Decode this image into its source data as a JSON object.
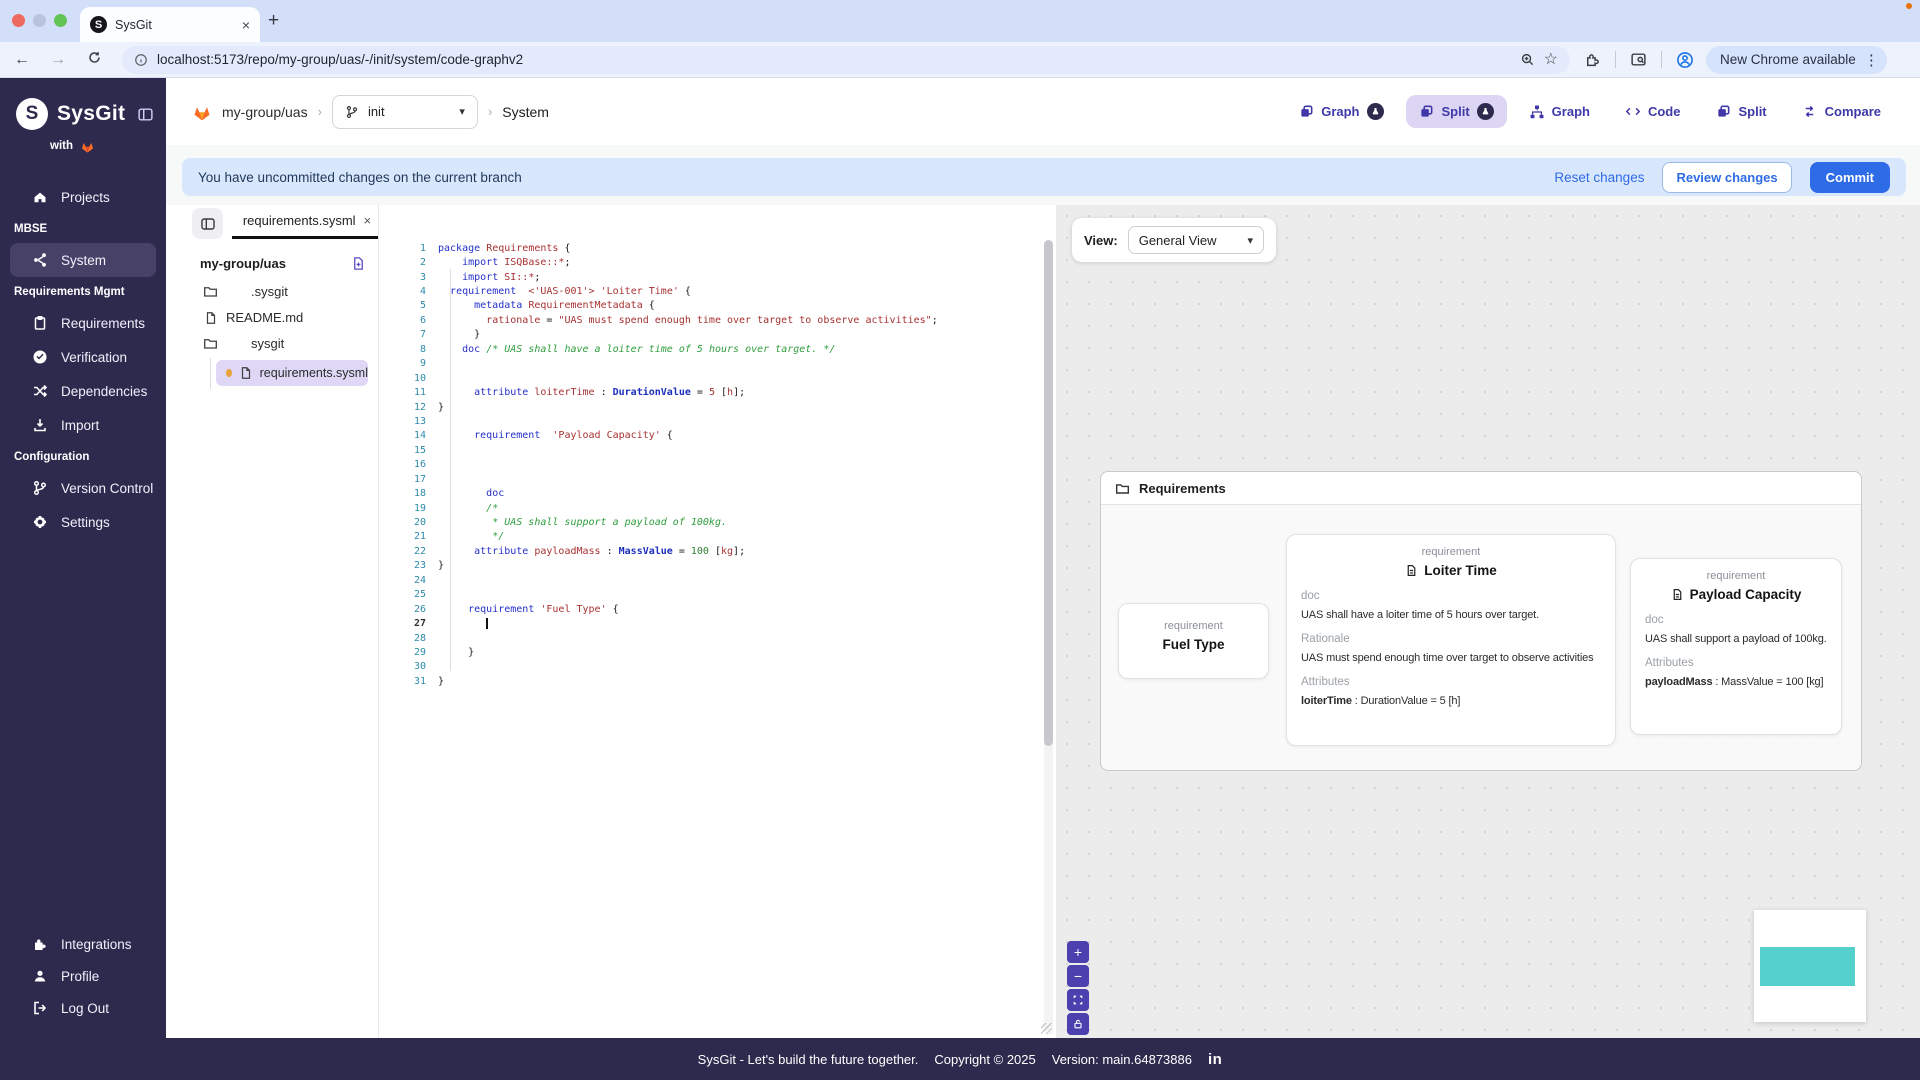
{
  "browser": {
    "tab_title": "SysGit",
    "favicon_letter": "S",
    "url": "localhost:5173/repo/my-group/uas/-/init/system/code-graphv2",
    "update_pill": "New Chrome available"
  },
  "icons": {
    "close": "×",
    "new-tab": "+",
    "back": "←",
    "forward": "→",
    "kebab": "⋮",
    "caret-down": "▾",
    "star": "☆",
    "plus": "+",
    "minus": "−",
    "linkedin": "in"
  },
  "sidebar": {
    "logo_text": "SysGit",
    "logo_letter": "S",
    "with_label": "with",
    "sections": [
      {
        "header": "",
        "items": [
          {
            "label": "Projects",
            "icon": "home"
          }
        ]
      },
      {
        "header": "MBSE",
        "items": [
          {
            "label": "System",
            "icon": "share-network",
            "active": true
          }
        ]
      },
      {
        "header": "Requirements Mgmt",
        "items": [
          {
            "label": "Requirements",
            "icon": "clipboard"
          },
          {
            "label": "Verification",
            "icon": "check-circle"
          },
          {
            "label": "Dependencies",
            "icon": "shuffle"
          },
          {
            "label": "Import",
            "icon": "import"
          }
        ]
      },
      {
        "header": "Configuration",
        "items": [
          {
            "label": "Version Control",
            "icon": "branch"
          },
          {
            "label": "Settings",
            "icon": "gear"
          }
        ]
      }
    ],
    "bottom_items": [
      {
        "label": "Integrations",
        "icon": "puzzle"
      },
      {
        "label": "Profile",
        "icon": "person"
      },
      {
        "label": "Log Out",
        "icon": "logout"
      }
    ]
  },
  "header": {
    "repo": "my-group/uas",
    "branch": "init",
    "page": "System",
    "view_buttons": [
      {
        "label": "Graph",
        "icon": "copy",
        "badge": true
      },
      {
        "label": "Split",
        "icon": "copy",
        "badge": true,
        "active": true
      },
      {
        "label": "Graph",
        "icon": "sitemap"
      },
      {
        "label": "Code",
        "icon": "code"
      },
      {
        "label": "Split",
        "icon": "copy"
      },
      {
        "label": "Compare",
        "icon": "compare"
      }
    ]
  },
  "banner": {
    "message": "You have uncommitted changes on the current branch",
    "reset_label": "Reset changes",
    "review_label": "Review changes",
    "commit_label": "Commit"
  },
  "explorer": {
    "tab_label": "requirements.sysml",
    "root_label": "my-group/uas",
    "tree": [
      {
        "label": ".sysgit",
        "type": "folder"
      },
      {
        "label": "README.md",
        "type": "file"
      },
      {
        "label": "sysgit",
        "type": "folder"
      }
    ],
    "selected_file": "requirements.sysml"
  },
  "editor": {
    "lines": [
      {
        "n": 1,
        "t": [
          [
            "k",
            "package"
          ],
          [
            "p",
            " "
          ],
          [
            "r",
            "Requirements"
          ],
          [
            "p",
            " {"
          ]
        ]
      },
      {
        "n": 2,
        "t": [
          [
            "p",
            "    "
          ],
          [
            "k",
            "import"
          ],
          [
            "p",
            " "
          ],
          [
            "r",
            "ISQBase::*"
          ],
          [
            "p",
            ";"
          ]
        ]
      },
      {
        "n": 3,
        "t": [
          [
            "p",
            "    "
          ],
          [
            "k",
            "import"
          ],
          [
            "p",
            " "
          ],
          [
            "r",
            "SI::*"
          ],
          [
            "p",
            ";"
          ]
        ]
      },
      {
        "n": 4,
        "t": [
          [
            "p",
            "  "
          ],
          [
            "k",
            "requirement"
          ],
          [
            "p",
            "  "
          ],
          [
            "r",
            "<'UAS-001'>"
          ],
          [
            "p",
            " "
          ],
          [
            "r",
            "'Loiter Time'"
          ],
          [
            "p",
            " {"
          ]
        ]
      },
      {
        "n": 5,
        "t": [
          [
            "p",
            "      "
          ],
          [
            "k",
            "metadata"
          ],
          [
            "p",
            " "
          ],
          [
            "r",
            "RequirementMetadata"
          ],
          [
            "p",
            " {"
          ]
        ]
      },
      {
        "n": 6,
        "t": [
          [
            "p",
            "        "
          ],
          [
            "r",
            "rationale"
          ],
          [
            "p",
            " = "
          ],
          [
            "r",
            "\"UAS must spend enough time over target to observe activities\""
          ],
          [
            "p",
            ";"
          ]
        ]
      },
      {
        "n": 7,
        "t": [
          [
            "p",
            "      }"
          ]
        ]
      },
      {
        "n": 8,
        "t": [
          [
            "p",
            "    "
          ],
          [
            "k",
            "doc"
          ],
          [
            "p",
            " "
          ],
          [
            "c",
            "/* UAS shall have a loiter time of 5 hours over target. */"
          ]
        ]
      },
      {
        "n": 9,
        "t": []
      },
      {
        "n": 10,
        "t": []
      },
      {
        "n": 11,
        "t": [
          [
            "p",
            "      "
          ],
          [
            "k",
            "attribute"
          ],
          [
            "p",
            " "
          ],
          [
            "r",
            "loiterTime"
          ],
          [
            "p",
            " : "
          ],
          [
            "b",
            "DurationValue"
          ],
          [
            "p",
            " = "
          ],
          [
            "r",
            "5"
          ],
          [
            "p",
            " ["
          ],
          [
            "r",
            "h"
          ],
          [
            "p",
            "];"
          ]
        ]
      },
      {
        "n": 12,
        "t": [
          [
            "p",
            "}"
          ]
        ]
      },
      {
        "n": 13,
        "t": []
      },
      {
        "n": 14,
        "t": [
          [
            "p",
            "      "
          ],
          [
            "k",
            "requirement"
          ],
          [
            "p",
            "  "
          ],
          [
            "r",
            "'Payload Capacity'"
          ],
          [
            "p",
            " {"
          ]
        ]
      },
      {
        "n": 15,
        "t": []
      },
      {
        "n": 16,
        "t": []
      },
      {
        "n": 17,
        "t": []
      },
      {
        "n": 18,
        "t": [
          [
            "p",
            "        "
          ],
          [
            "k",
            "doc"
          ]
        ]
      },
      {
        "n": 19,
        "t": [
          [
            "p",
            "        "
          ],
          [
            "c",
            "/*"
          ]
        ]
      },
      {
        "n": 20,
        "t": [
          [
            "p",
            "         "
          ],
          [
            "c",
            "* UAS shall support a payload of 100kg."
          ]
        ]
      },
      {
        "n": 21,
        "t": [
          [
            "p",
            "         "
          ],
          [
            "c",
            "*/"
          ]
        ]
      },
      {
        "n": 22,
        "t": [
          [
            "p",
            "      "
          ],
          [
            "k",
            "attribute"
          ],
          [
            "p",
            " "
          ],
          [
            "r",
            "payloadMass"
          ],
          [
            "p",
            " : "
          ],
          [
            "b",
            "MassValue"
          ],
          [
            "p",
            " = "
          ],
          [
            "g",
            "100"
          ],
          [
            "p",
            " ["
          ],
          [
            "r",
            "kg"
          ],
          [
            "p",
            "];"
          ]
        ]
      },
      {
        "n": 23,
        "t": [
          [
            "p",
            "}"
          ]
        ]
      },
      {
        "n": 24,
        "t": []
      },
      {
        "n": 25,
        "t": []
      },
      {
        "n": 26,
        "t": [
          [
            "p",
            "     "
          ],
          [
            "k",
            "requirement"
          ],
          [
            "p",
            " "
          ],
          [
            "r",
            "'Fuel Type'"
          ],
          [
            "p",
            " {"
          ]
        ]
      },
      {
        "n": 27,
        "t": [
          [
            "p",
            "        "
          ],
          [
            "cur",
            ""
          ]
        ],
        "active": true
      },
      {
        "n": 28,
        "t": []
      },
      {
        "n": 29,
        "t": [
          [
            "p",
            "     }"
          ]
        ]
      },
      {
        "n": 30,
        "t": []
      },
      {
        "n": 31,
        "t": [
          [
            "p",
            "}"
          ]
        ]
      }
    ]
  },
  "graph": {
    "view_label": "View:",
    "view_value": "General View",
    "container_title": "Requirements",
    "cards": {
      "fuel": {
        "kind": "requirement",
        "title": "Fuel Type"
      },
      "loiter": {
        "kind": "requirement",
        "title": "Loiter Time",
        "doc_label": "doc",
        "doc_text": "UAS shall have a loiter time of 5 hours over target.",
        "rationale_label": "Rationale",
        "rationale_text": "UAS must spend enough time over target to observe activities",
        "attributes_label": "Attributes",
        "attr_name": "loiterTime",
        "attr_rest": " : DurationValue = 5 [h]"
      },
      "payload": {
        "kind": "requirement",
        "title": "Payload Capacity",
        "doc_label": "doc",
        "doc_text": "UAS shall support a payload of 100kg.",
        "attributes_label": "Attributes",
        "attr_name": "payloadMass",
        "attr_rest": " : MassValue = 100 [kg]"
      }
    }
  },
  "footer": {
    "tagline": "SysGit - Let's build the future together.",
    "copyright": "Copyright © 2025",
    "version": "Version: main.64873886"
  }
}
